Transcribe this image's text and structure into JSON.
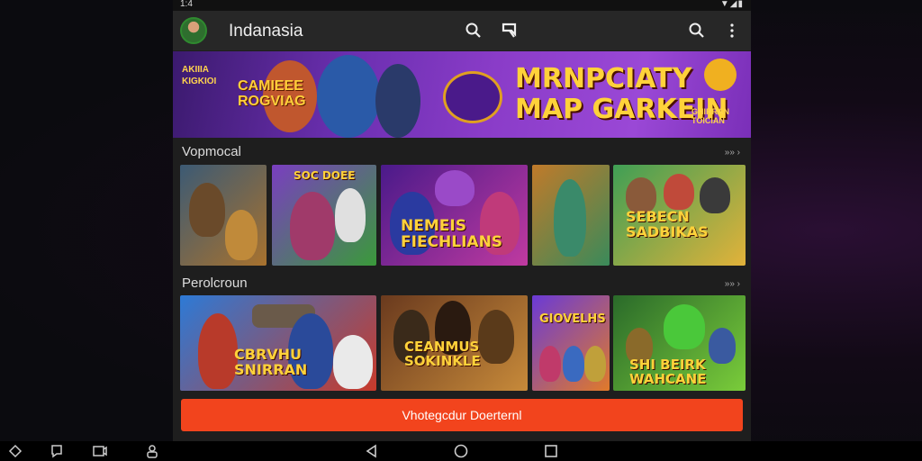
{
  "status_bar": {
    "time": "1:4",
    "icons": "▼◢▮"
  },
  "app": {
    "title": "Indanasia"
  },
  "banner": {
    "corner_text": "AKIIIA KIGKIOI",
    "game_text": "CAMIEEE ROGVIAG",
    "title_line1": "MRNPCIATY",
    "title_line2": "MAP GARKEIN",
    "badge_text": "GHIRRAN TOICIAN"
  },
  "sections": [
    {
      "label": "Vopmocal",
      "more": "»» ›",
      "tiles": [
        {
          "title": "",
          "colors": [
            "#3c5a74",
            "#a8722e"
          ]
        },
        {
          "title": "SOC DOEE",
          "colors": [
            "#7a3ec0",
            "#3a9a3a"
          ]
        },
        {
          "title": "NEMEIS FIECHLIANS",
          "colors": [
            "#4a1a8a",
            "#c03aa0"
          ]
        },
        {
          "title": "",
          "colors": [
            "#c07a2a",
            "#3a8a5a"
          ]
        },
        {
          "title": "SEBECN SADBIKAS",
          "colors": [
            "#3f9f55",
            "#e2b23a"
          ]
        }
      ]
    },
    {
      "label": "Perolcroun",
      "more": "»» ›",
      "tiles": [
        {
          "title": "CBRVHU SNIRRAN",
          "colors": [
            "#2d7ad6",
            "#c83a2a"
          ]
        },
        {
          "title": "CEANMUS SOKINKLE",
          "colors": [
            "#6a3a1e",
            "#c78a3a"
          ]
        },
        {
          "title": "GIOVELHS",
          "colors": [
            "#6a3ad6",
            "#e07a2a"
          ]
        },
        {
          "title": "SHI BEIRK WAHCANE",
          "colors": [
            "#2a6a2a",
            "#7acc3a"
          ]
        }
      ]
    }
  ],
  "cta": {
    "label": "Vhotegcdur Doerternl"
  }
}
